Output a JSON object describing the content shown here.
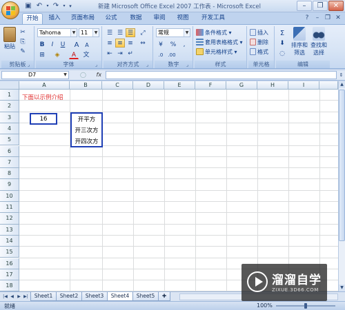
{
  "window": {
    "title": "新建 Microsoft Office Excel 2007 工作表 - Microsoft Excel"
  },
  "ribbon": {
    "tabs": [
      "开始",
      "插入",
      "页面布局",
      "公式",
      "数据",
      "审阅",
      "视图",
      "开发工具"
    ],
    "active_tab": "开始",
    "clipboard": {
      "paste": "粘贴",
      "label": "剪贴板"
    },
    "font": {
      "name": "Tahoma",
      "size": "11",
      "label": "字体",
      "bold": "B",
      "italic": "I",
      "underline": "U",
      "grow": "A",
      "shrink": "A",
      "color_letter": "A"
    },
    "alignment": {
      "label": "对齐方式"
    },
    "number": {
      "format": "常规",
      "label": "数字",
      "percent": "%",
      "comma": ","
    },
    "styles": {
      "conditional": "条件格式",
      "table": "套用表格格式",
      "cell": "单元格样式",
      "label": "样式"
    },
    "cells": {
      "insert": "插入",
      "delete": "删除",
      "format": "格式",
      "label": "单元格"
    },
    "editing": {
      "sigma": "Σ",
      "sort": "排序和\n筛选",
      "sort_line1": "排序和",
      "sort_line2": "筛选",
      "find_line1": "查找和",
      "find_line2": "选择",
      "label": "编辑"
    }
  },
  "formula_bar": {
    "name_box": "D7",
    "fx": "fx",
    "value": ""
  },
  "grid": {
    "columns": [
      "A",
      "B",
      "C",
      "D",
      "E",
      "F",
      "G",
      "H",
      "I"
    ],
    "rows": [
      "1",
      "2",
      "3",
      "4",
      "5",
      "6",
      "7",
      "8",
      "9",
      "10",
      "11",
      "12",
      "13",
      "14",
      "15",
      "16",
      "17",
      "18"
    ],
    "cells": {
      "A1": "下面以示例介绍",
      "A3": "16",
      "B3": "开平方",
      "B4": "开三次方",
      "B5": "开四次方"
    }
  },
  "sheets": [
    "Sheet1",
    "Sheet2",
    "Sheet3",
    "Sheet4",
    "Sheet5"
  ],
  "active_sheet": "Sheet4",
  "status": {
    "mode": "就绪",
    "zoom": "100%"
  },
  "watermark": {
    "name": "溜溜自学",
    "url": "ZIXUE.3D66.COM"
  },
  "colors": {
    "accent": "#15428b",
    "red_text": "#e03030",
    "selection_border": "#1f3fb5"
  }
}
